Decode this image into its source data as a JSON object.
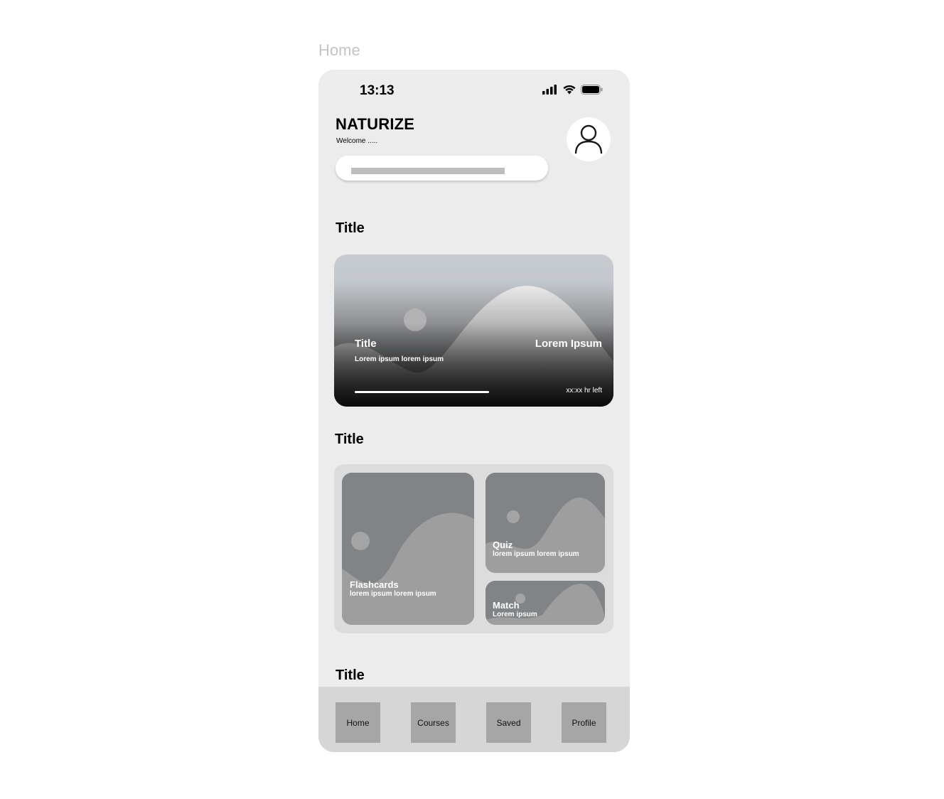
{
  "frame_label": "Home",
  "status_bar": {
    "time": "13:13"
  },
  "header": {
    "brand": "NATURIZE",
    "welcome": "Welcome ....."
  },
  "sections": [
    {
      "title": "Title"
    },
    {
      "title": "Title"
    },
    {
      "title": "Title"
    }
  ],
  "hero_card": {
    "title": "Title",
    "subtitle": "Lorem ipsum lorem ipsum",
    "right_label": "Lorem Ipsum",
    "time_left": "xx:xx hr left",
    "progress": 1.0
  },
  "tiles": [
    {
      "title": "Flashcards",
      "subtitle": "lorem ipsum lorem ipsum"
    },
    {
      "title": "Quiz",
      "subtitle": "lorem ipsum lorem ipsum"
    },
    {
      "title": "Match",
      "subtitle": "Lorem ipsum"
    }
  ],
  "nav": {
    "items": [
      {
        "label": "Home"
      },
      {
        "label": "Courses"
      },
      {
        "label": "Saved"
      },
      {
        "label": "Profile"
      }
    ]
  },
  "icons": {
    "signal": "signal-icon",
    "wifi": "wifi-icon",
    "battery": "battery-icon",
    "avatar": "user-icon"
  }
}
